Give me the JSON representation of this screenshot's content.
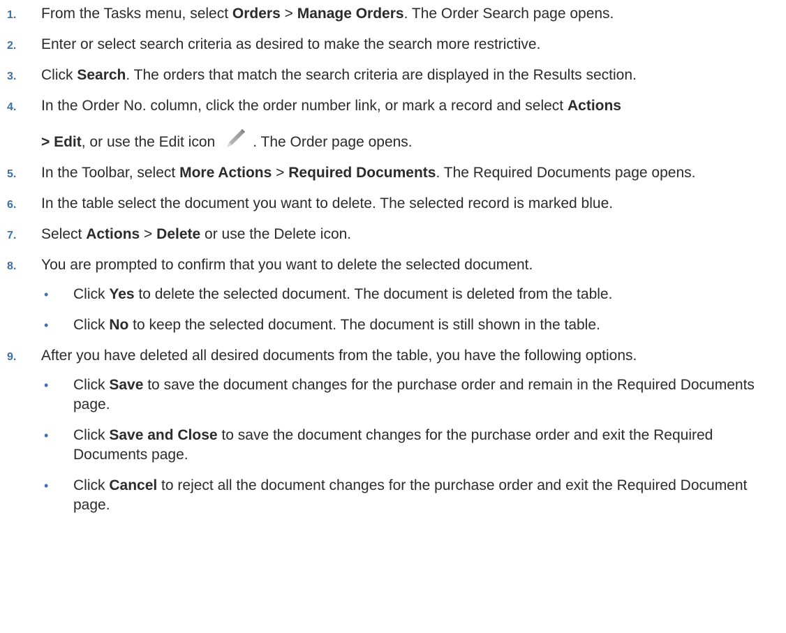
{
  "steps": [
    {
      "num": "1.",
      "parts": [
        {
          "t": "From the Tasks menu, select "
        },
        {
          "t": "Orders",
          "b": true
        },
        {
          "t": " > "
        },
        {
          "t": "Manage Orders",
          "b": true
        },
        {
          "t": ". The Order Search page opens."
        }
      ]
    },
    {
      "num": "2.",
      "parts": [
        {
          "t": "Enter or select search criteria as desired to make the search more restrictive."
        }
      ]
    },
    {
      "num": "3.",
      "parts": [
        {
          "t": "Click "
        },
        {
          "t": "Search",
          "b": true
        },
        {
          "t": ". The orders that match the search criteria are displayed in the Results section."
        }
      ]
    },
    {
      "num": "4.",
      "line1": [
        {
          "t": "In the Order No. column, click the order number link, or mark a record and select "
        },
        {
          "t": "Actions",
          "b": true
        }
      ],
      "line2_before": [
        {
          "t": "> Edit",
          "b": true
        },
        {
          "t": ", or use the Edit icon"
        }
      ],
      "icon": "pencil-edit-icon",
      "line2_after": ". The Order page opens."
    },
    {
      "num": "5.",
      "parts": [
        {
          "t": "In the Toolbar, select "
        },
        {
          "t": "More Actions",
          "b": true
        },
        {
          "t": " > "
        },
        {
          "t": "Required Documents",
          "b": true
        },
        {
          "t": ". The Required Documents page opens."
        }
      ]
    },
    {
      "num": "6.",
      "parts": [
        {
          "t": "In the table select the document you want to delete. The selected record is marked blue."
        }
      ]
    },
    {
      "num": "7.",
      "parts": [
        {
          "t": "Select "
        },
        {
          "t": "Actions",
          "b": true
        },
        {
          "t": " > "
        },
        {
          "t": "Delete",
          "b": true
        },
        {
          "t": " or use the Delete icon."
        }
      ]
    },
    {
      "num": "8.",
      "parts": [
        {
          "t": "You are prompted to confirm that you want to delete the selected document."
        }
      ],
      "bullets": [
        [
          {
            "t": "Click "
          },
          {
            "t": "Yes",
            "b": true
          },
          {
            "t": " to delete the selected document. The document is deleted from the table."
          }
        ],
        [
          {
            "t": "Click "
          },
          {
            "t": "No",
            "b": true
          },
          {
            "t": " to keep the selected document. The document is still shown in the table."
          }
        ]
      ]
    },
    {
      "num": "9.",
      "parts": [
        {
          "t": "After you have deleted all desired documents from the table, you have the following options."
        }
      ],
      "bullets": [
        [
          {
            "t": "Click "
          },
          {
            "t": "Save",
            "b": true
          },
          {
            "t": " to save the document changes for the purchase order and remain in the Required Documents page."
          }
        ],
        [
          {
            "t": "Click "
          },
          {
            "t": "Save and Close",
            "b": true
          },
          {
            "t": " to save the document changes for the purchase order and exit the Required Documents page."
          }
        ],
        [
          {
            "t": "Click "
          },
          {
            "t": "Cancel",
            "b": true
          },
          {
            "t": " to reject all the document changes for the purchase order and exit the Required Document page."
          }
        ]
      ]
    }
  ],
  "colors": {
    "accent": "#3d6fa8",
    "text": "#2b2b2b"
  }
}
